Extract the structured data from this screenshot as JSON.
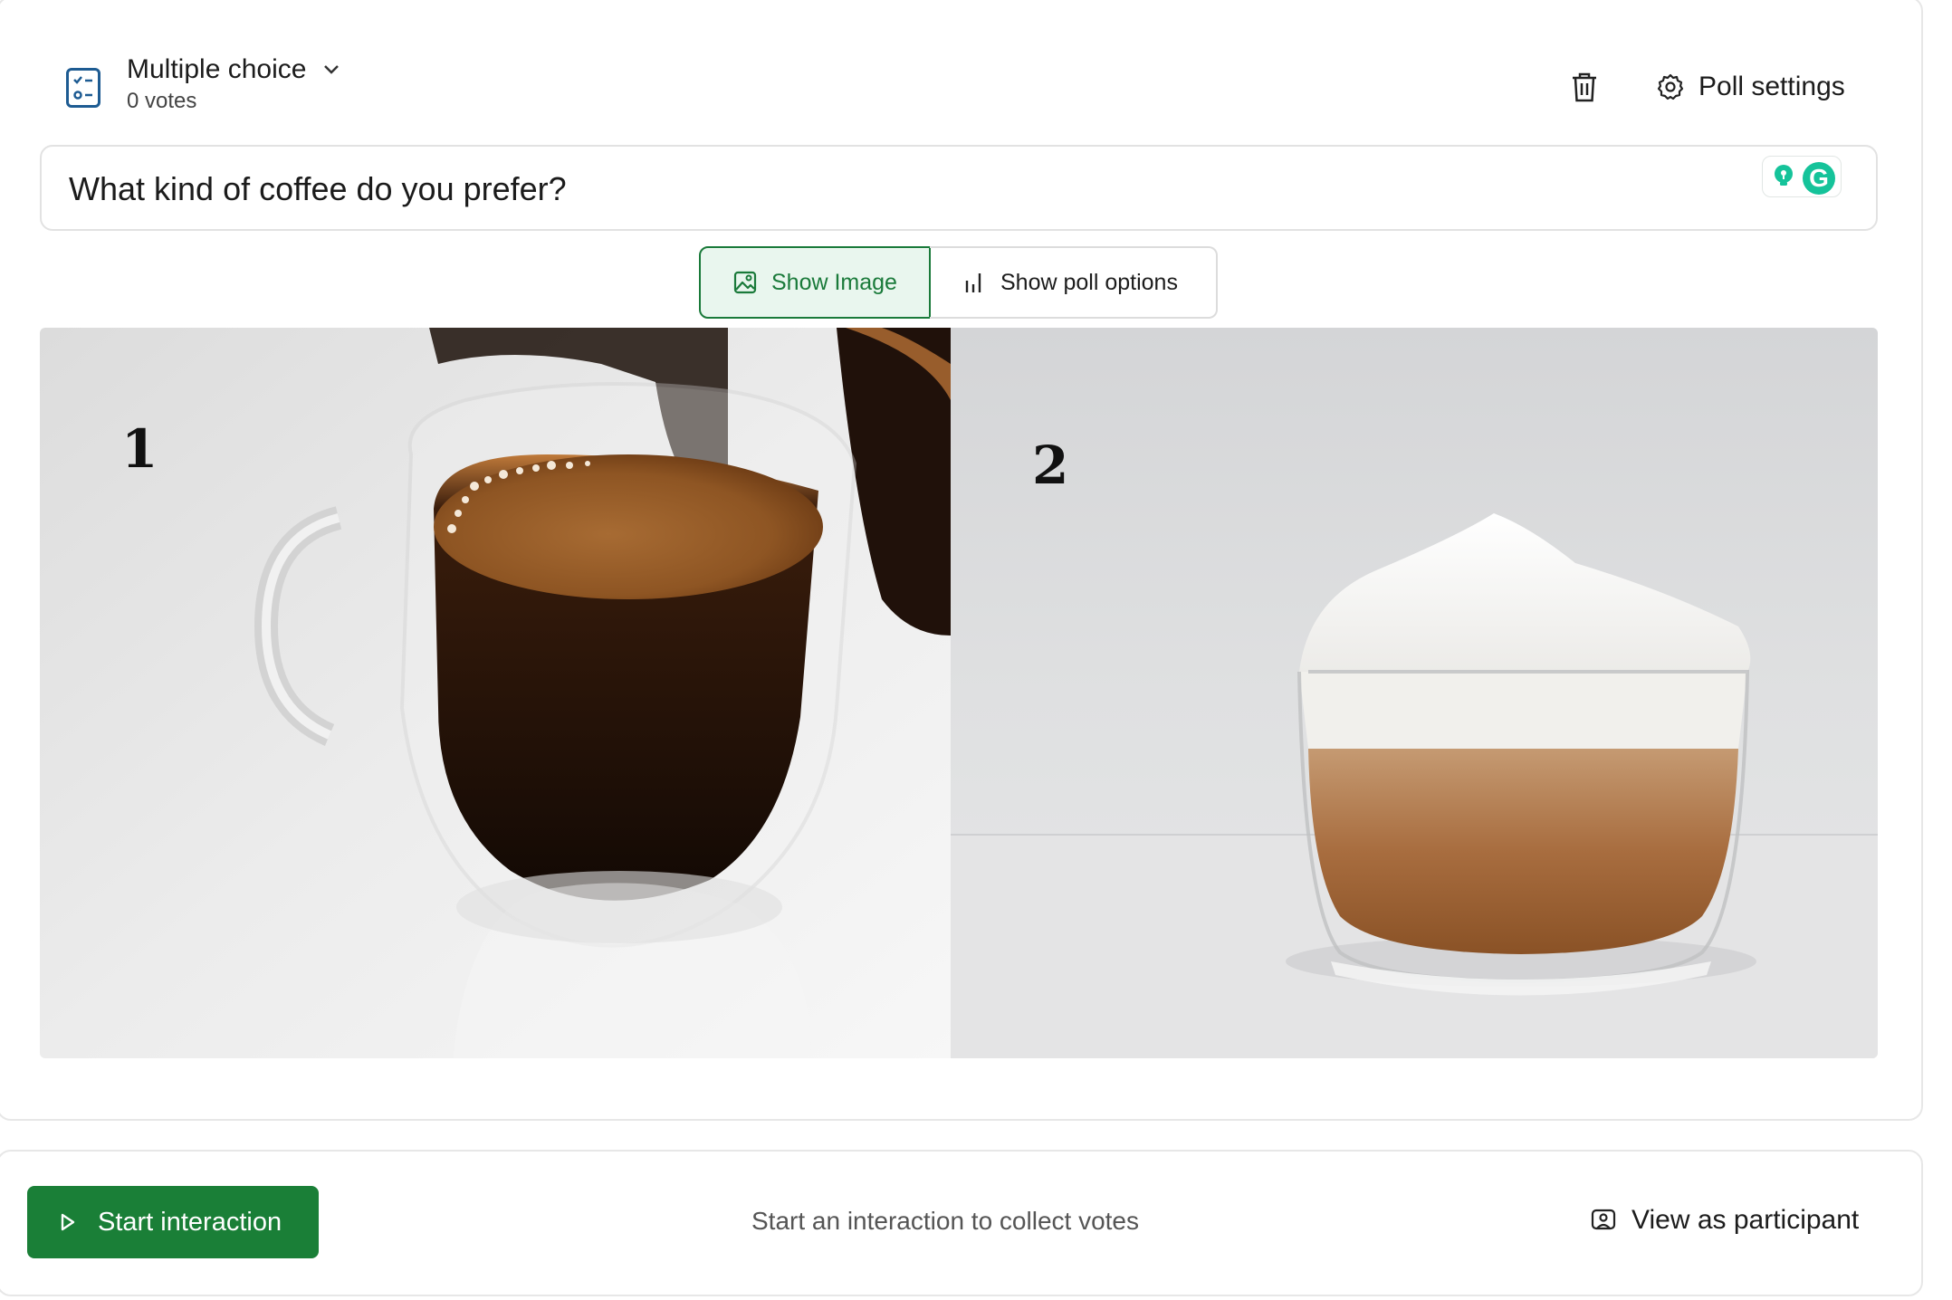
{
  "poll": {
    "type_label": "Multiple choice",
    "votes_label": "0 votes",
    "settings_label": "Poll settings",
    "question": "What kind of coffee do you prefer?"
  },
  "view_toggle": {
    "show_image": "Show Image",
    "show_options": "Show poll options",
    "active": "show_image"
  },
  "image": {
    "panes": [
      {
        "number": "1",
        "subject": "espresso in double-wall glass"
      },
      {
        "number": "2",
        "subject": "cappuccino with milk foam in glass"
      }
    ]
  },
  "footer": {
    "start_label": "Start interaction",
    "hint": "Start an interaction to collect votes",
    "participant_label": "View as participant"
  },
  "colors": {
    "accent_green": "#1a7f37",
    "active_tab_bg": "#e9f6ee",
    "icon_blue": "#1d5b92",
    "grammarly_green": "#15c39a"
  },
  "icons": [
    "poll-list-icon",
    "chevron-down-icon",
    "trash-icon",
    "gear-icon",
    "lightbulb-icon",
    "grammarly-icon",
    "image-icon",
    "bar-chart-icon",
    "play-icon",
    "participant-icon"
  ]
}
